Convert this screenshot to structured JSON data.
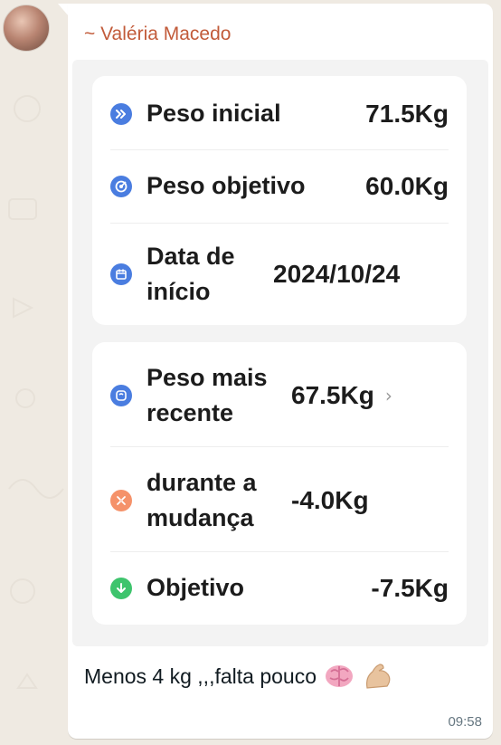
{
  "message": {
    "sender": "~ Valéria Macedo",
    "caption": "Menos 4 kg ,,,falta pouco",
    "time": "09:58"
  },
  "card1": {
    "rows": [
      {
        "label": "Peso inicial",
        "value": "71.5Kg",
        "icon": "fast-forward-icon",
        "color": "#4a7de0"
      },
      {
        "label": "Peso objetivo",
        "value": "60.0Kg",
        "icon": "target-icon",
        "color": "#4a7de0"
      },
      {
        "label": "Data de início",
        "value": "2024/10/24",
        "icon": "calendar-icon",
        "color": "#4a7de0"
      }
    ]
  },
  "card2": {
    "rows": [
      {
        "label": "Peso mais recente",
        "value": "67.5Kg",
        "icon": "scale-icon",
        "color": "#4a7de0",
        "chevron": "›"
      },
      {
        "label": "durante a mudança",
        "value": "-4.0Kg",
        "icon": "shrink-icon",
        "color": "#f5926a"
      },
      {
        "label": "Objetivo",
        "value": "-7.5Kg",
        "icon": "arrow-down-icon",
        "color": "#3ec46d"
      }
    ]
  }
}
